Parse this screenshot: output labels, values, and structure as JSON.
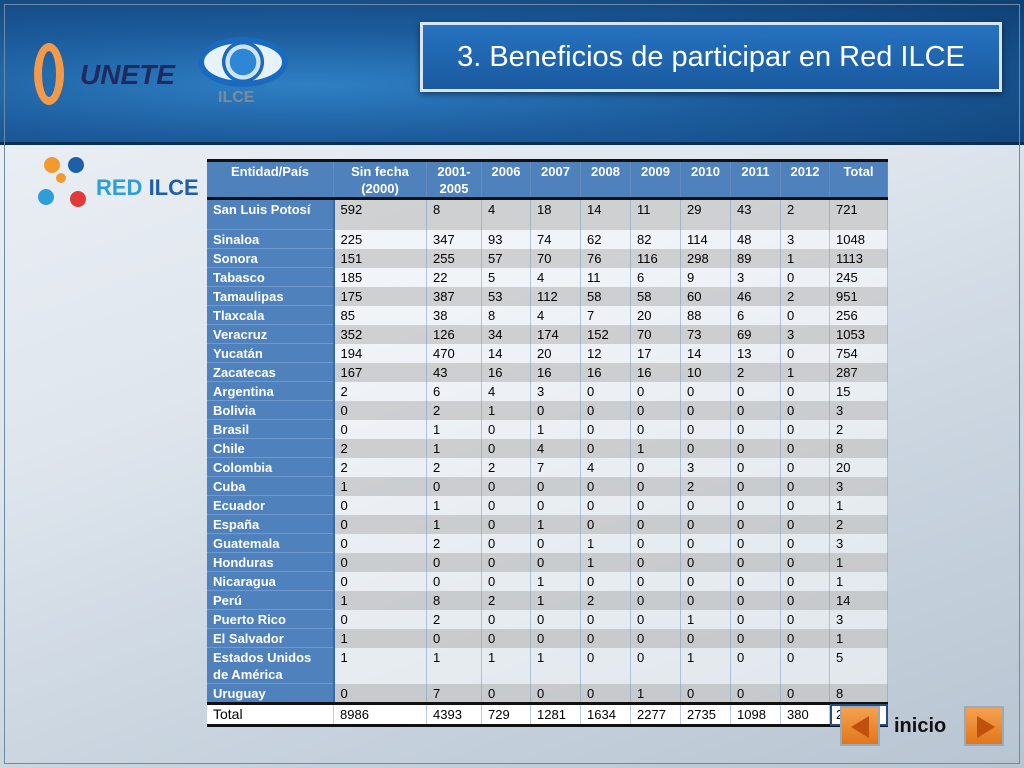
{
  "title": "3. Beneficios de participar en Red ILCE",
  "logos": {
    "unete": "UNETE",
    "ilce": "ILCE",
    "red_ilce": "RED ILCE"
  },
  "table": {
    "headers": [
      "Entidad/País",
      "Sin fecha (2000)",
      "2001-2005",
      "2006",
      "2007",
      "2008",
      "2009",
      "2010",
      "2011",
      "2012",
      "Total"
    ],
    "rows": [
      [
        "San Luis Potosí",
        "592",
        "8",
        "4",
        "18",
        "14",
        "11",
        "29",
        "43",
        "2",
        "721"
      ],
      [
        "Sinaloa",
        "225",
        "347",
        "93",
        "74",
        "62",
        "82",
        "114",
        "48",
        "3",
        "1048"
      ],
      [
        "Sonora",
        "151",
        "255",
        "57",
        "70",
        "76",
        "116",
        "298",
        "89",
        "1",
        "1113"
      ],
      [
        "Tabasco",
        "185",
        "22",
        "5",
        "4",
        "11",
        "6",
        "9",
        "3",
        "0",
        "245"
      ],
      [
        "Tamaulipas",
        "175",
        "387",
        "53",
        "112",
        "58",
        "58",
        "60",
        "46",
        "2",
        "951"
      ],
      [
        "Tlaxcala",
        "85",
        "38",
        "8",
        "4",
        "7",
        "20",
        "88",
        "6",
        "0",
        "256"
      ],
      [
        "Veracruz",
        "352",
        "126",
        "34",
        "174",
        "152",
        "70",
        "73",
        "69",
        "3",
        "1053"
      ],
      [
        "Yucatán",
        "194",
        "470",
        "14",
        "20",
        "12",
        "17",
        "14",
        "13",
        "0",
        "754"
      ],
      [
        "Zacatecas",
        "167",
        "43",
        "16",
        "16",
        "16",
        "16",
        "10",
        "2",
        "1",
        "287"
      ],
      [
        "Argentina",
        "2",
        "6",
        "4",
        "3",
        "0",
        "0",
        "0",
        "0",
        "0",
        "15"
      ],
      [
        "Bolivia",
        "0",
        "2",
        "1",
        "0",
        "0",
        "0",
        "0",
        "0",
        "0",
        "3"
      ],
      [
        "Brasil",
        "0",
        "1",
        "0",
        "1",
        "0",
        "0",
        "0",
        "0",
        "0",
        "2"
      ],
      [
        "Chile",
        "2",
        "1",
        "0",
        "4",
        "0",
        "1",
        "0",
        "0",
        "0",
        "8"
      ],
      [
        "Colombia",
        "2",
        "2",
        "2",
        "7",
        "4",
        "0",
        "3",
        "0",
        "0",
        "20"
      ],
      [
        "Cuba",
        "1",
        "0",
        "0",
        "0",
        "0",
        "0",
        "2",
        "0",
        "0",
        "3"
      ],
      [
        "Ecuador",
        "0",
        "1",
        "0",
        "0",
        "0",
        "0",
        "0",
        "0",
        "0",
        "1"
      ],
      [
        "España",
        "0",
        "1",
        "0",
        "1",
        "0",
        "0",
        "0",
        "0",
        "0",
        "2"
      ],
      [
        "Guatemala",
        "0",
        "2",
        "0",
        "0",
        "1",
        "0",
        "0",
        "0",
        "0",
        "3"
      ],
      [
        "Honduras",
        "0",
        "0",
        "0",
        "0",
        "1",
        "0",
        "0",
        "0",
        "0",
        "1"
      ],
      [
        "Nicaragua",
        "0",
        "0",
        "0",
        "1",
        "0",
        "0",
        "0",
        "0",
        "0",
        "1"
      ],
      [
        "Perú",
        "1",
        "8",
        "2",
        "1",
        "2",
        "0",
        "0",
        "0",
        "0",
        "14"
      ],
      [
        "Puerto Rico",
        "0",
        "2",
        "0",
        "0",
        "0",
        "0",
        "1",
        "0",
        "0",
        "3"
      ],
      [
        "El Salvador",
        "1",
        "0",
        "0",
        "0",
        "0",
        "0",
        "0",
        "0",
        "0",
        "1"
      ],
      [
        "Estados Unidos de América",
        "1",
        "1",
        "1",
        "1",
        "0",
        "0",
        "1",
        "0",
        "0",
        "5"
      ],
      [
        "Uruguay",
        "0",
        "7",
        "0",
        "0",
        "0",
        "1",
        "0",
        "0",
        "0",
        "8"
      ]
    ],
    "total": [
      "Total",
      "8986",
      "4393",
      "729",
      "1281",
      "1634",
      "2277",
      "2735",
      "1098",
      "380",
      "23513"
    ]
  },
  "nav": {
    "prev_icon": "arrow-left-icon",
    "next_icon": "arrow-right-icon",
    "home_label": "inicio"
  }
}
